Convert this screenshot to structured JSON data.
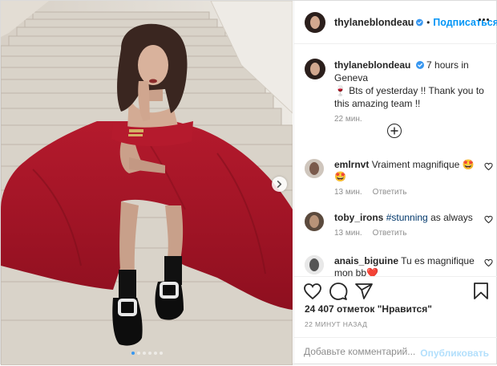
{
  "post": {
    "author": "thylaneblondeau",
    "follow_label": "Подписаться",
    "separator": "•",
    "carousel_dots": 6,
    "accent_color": "#0095f6",
    "dress_color": "#b0182b"
  },
  "caption": {
    "author": "thylaneblondeau",
    "line1": "7 hours in Geneva",
    "emoji": "🍷",
    "line2": " Bts of yesterday !! Thank you to this amazing team !!",
    "time": "22 мин."
  },
  "comments": [
    {
      "user": "emlrnvt",
      "text": "Vraiment magnifique 🤩",
      "text2": "🤩",
      "time": "13 мин.",
      "reply": "Ответить"
    },
    {
      "user": "toby_irons",
      "hashtag": "#stunning",
      "text": " as always",
      "time": "13 мин.",
      "reply": "Ответить"
    },
    {
      "user": "anais_biguine",
      "text": "Tu es magnifique",
      "text2": "mon bb❤️"
    }
  ],
  "actions": {
    "likes": "24 407 отметок \"Нравится\"",
    "time": "22 МИНУТ НАЗАД",
    "comment_placeholder": "Добавьте комментарий...",
    "publish_label": "Опубликовать"
  },
  "icons": [
    "verified-icon",
    "more-icon",
    "plus-circle-icon",
    "heart-icon",
    "comment-icon",
    "share-icon",
    "bookmark-icon",
    "chevron-right-icon"
  ]
}
